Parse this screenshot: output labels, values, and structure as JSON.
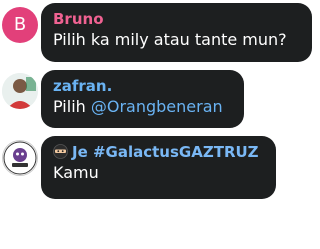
{
  "messages": [
    {
      "avatar_letter": "B",
      "avatar_color": "#e2407a",
      "sender": "Bruno",
      "sender_color": "#f06292",
      "text": "Pilih ka mily atau tante mun?"
    },
    {
      "avatar_icon": "person-photo-avatar",
      "sender": "zafran.",
      "sender_color": "#6ab3f3",
      "text_prefix": "Pilih ",
      "mention": "@Orangbeneran"
    },
    {
      "avatar_icon": "galactus-logo-avatar",
      "sender_icon": "ninja-emoji-icon",
      "sender": "Je #GalactusGAZTRUZ",
      "sender_color": "#7ab8f5",
      "text": "Kamu"
    }
  ]
}
